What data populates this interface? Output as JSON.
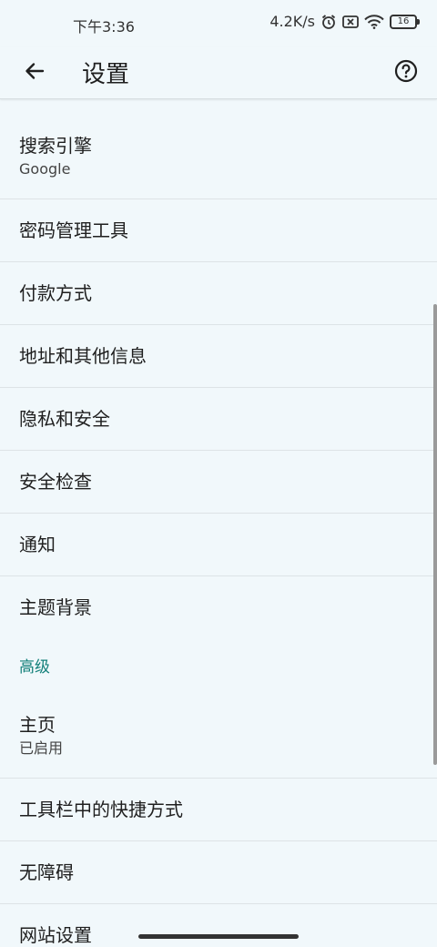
{
  "status_bar": {
    "time": "下午3:36",
    "network_speed": "4.2K/s",
    "battery_level": "16",
    "icons": [
      "alarm-icon",
      "sim-off-icon",
      "wifi-icon",
      "battery-icon"
    ]
  },
  "app_bar": {
    "title": "设置",
    "back_icon": "arrow-back-icon",
    "help_icon": "help-icon"
  },
  "items": {
    "search_engine": {
      "title": "搜索引擎",
      "subtitle": "Google"
    },
    "passwords": {
      "title": "密码管理工具"
    },
    "payment": {
      "title": "付款方式"
    },
    "addresses": {
      "title": "地址和其他信息"
    },
    "privacy": {
      "title": "隐私和安全"
    },
    "safety_check": {
      "title": "安全检查"
    },
    "notifications": {
      "title": "通知"
    },
    "theme": {
      "title": "主题背景"
    },
    "advanced_header": "高级",
    "homepage": {
      "title": "主页",
      "subtitle": "已启用"
    },
    "toolbar_shortcut": {
      "title": "工具栏中的快捷方式"
    },
    "accessibility": {
      "title": "无障碍"
    },
    "site_settings": {
      "title": "网站设置"
    }
  },
  "colors": {
    "background": "#f1f8fb",
    "accent": "#13807a",
    "divider": "#dde3e6"
  }
}
